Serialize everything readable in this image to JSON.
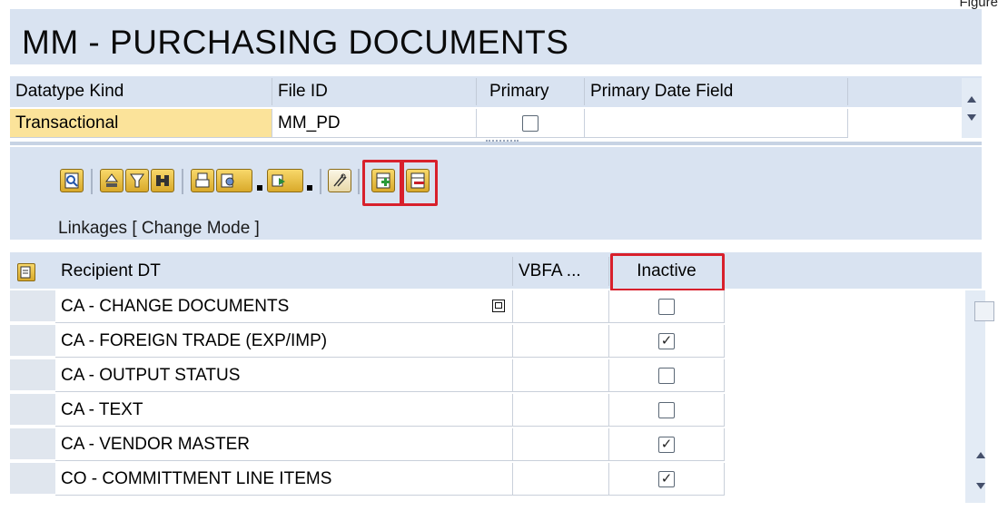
{
  "corner_label": "Figure",
  "title": "MM - PURCHASING DOCUMENTS",
  "top_grid": {
    "headers": [
      "Datatype Kind",
      "File ID",
      "Primary",
      "Primary Date Field"
    ],
    "row": {
      "datatype_kind": "Transactional",
      "file_id": "MM_PD",
      "primary_checked": false,
      "primary_date_field": ""
    }
  },
  "toolbar": {
    "icons": [
      "details-icon",
      "sort-ascending-icon",
      "filter-icon",
      "find-icon",
      "print-icon",
      "view-icon",
      "export-icon",
      "settings-icon",
      "insert-row-icon",
      "delete-row-icon"
    ]
  },
  "linkages_title": "Linkages [ Change Mode ]",
  "bottom_grid": {
    "headers": [
      "Recipient DT",
      "VBFA ...",
      "Inactive"
    ],
    "rows": [
      {
        "recipient": "CA - CHANGE DOCUMENTS",
        "vbfa": "",
        "inactive": false,
        "selected": true
      },
      {
        "recipient": "CA - FOREIGN TRADE (EXP/IMP)",
        "vbfa": "",
        "inactive": true,
        "selected": false
      },
      {
        "recipient": "CA - OUTPUT STATUS",
        "vbfa": "",
        "inactive": false,
        "selected": false
      },
      {
        "recipient": "CA - TEXT",
        "vbfa": "",
        "inactive": false,
        "selected": false
      },
      {
        "recipient": "CA - VENDOR MASTER",
        "vbfa": "",
        "inactive": true,
        "selected": false
      },
      {
        "recipient": "CO - COMMITTMENT LINE ITEMS",
        "vbfa": "",
        "inactive": true,
        "selected": false
      }
    ]
  },
  "colors": {
    "panel": "#d9e3f1",
    "selected_row": "#fbe39a",
    "highlight_box": "#d8202c",
    "button": "#f0c84a"
  }
}
